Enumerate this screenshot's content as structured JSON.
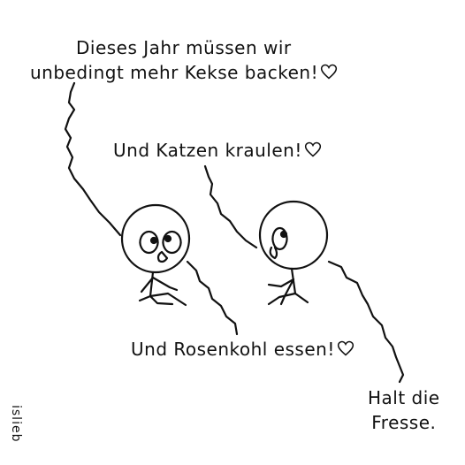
{
  "comic": {
    "speech_1_line1": "Dieses Jahr müssen wir",
    "speech_1_line2": "unbedingt mehr Kekse backen!",
    "speech_2": "Und Katzen kraulen!",
    "speech_3": "Und Rosenkohl essen!",
    "speech_4_line1": "Halt die",
    "speech_4_line2": "Fresse.",
    "signature": "islieb",
    "heart_icon": "heart-outline-icon",
    "ink_color": "#111111",
    "background_color": "#ffffff"
  }
}
